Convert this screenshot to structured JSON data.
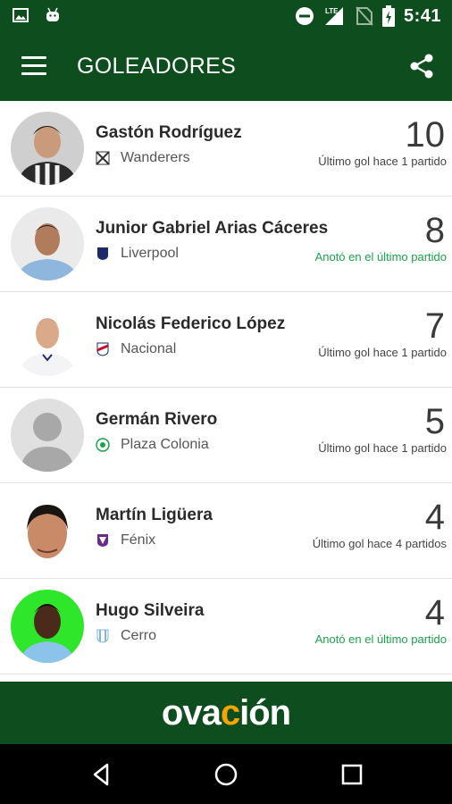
{
  "status_bar": {
    "time": "5:41",
    "network_label": "LTE",
    "icons": [
      "image-icon",
      "android-icon",
      "do-not-disturb-icon",
      "signal-icon",
      "no-sim-icon",
      "battery-charging-icon"
    ]
  },
  "app_bar": {
    "title": "GOLEADORES",
    "menu_icon": "hamburger-menu-icon",
    "share_icon": "share-icon"
  },
  "colors": {
    "brand_green": "#0d4d1e",
    "recent_goal_green": "#1aa34a",
    "logo_accent": "#f5a400"
  },
  "players": [
    {
      "name": "Gastón Rodríguez",
      "team": "Wanderers",
      "goals": "10",
      "last_goal": "Último gol hace 1 partido",
      "recent": false,
      "avatar": "photo"
    },
    {
      "name": "Junior Gabriel Arias Cáceres",
      "team": "Liverpool",
      "goals": "8",
      "last_goal": "Anotó en el último partido",
      "recent": true,
      "avatar": "photo"
    },
    {
      "name": "Nicolás Federico López",
      "team": "Nacional",
      "goals": "7",
      "last_goal": "Último gol hace 1 partido",
      "recent": false,
      "avatar": "photo"
    },
    {
      "name": "Germán Rivero",
      "team": "Plaza Colonia",
      "goals": "5",
      "last_goal": "Último gol hace 1 partido",
      "recent": false,
      "avatar": "placeholder"
    },
    {
      "name": "Martín Ligüera",
      "team": "Fénix",
      "goals": "4",
      "last_goal": "Último gol hace 4 partidos",
      "recent": false,
      "avatar": "photo"
    },
    {
      "name": "Hugo Silveira",
      "team": "Cerro",
      "goals": "4",
      "last_goal": "Anotó en el último partido",
      "recent": true,
      "avatar": "photo"
    }
  ],
  "banner": {
    "logo_before": "ova",
    "logo_accent": "c",
    "logo_after": "ión"
  },
  "nav_bar": {
    "buttons": [
      "back-icon",
      "home-icon",
      "recents-icon"
    ]
  }
}
